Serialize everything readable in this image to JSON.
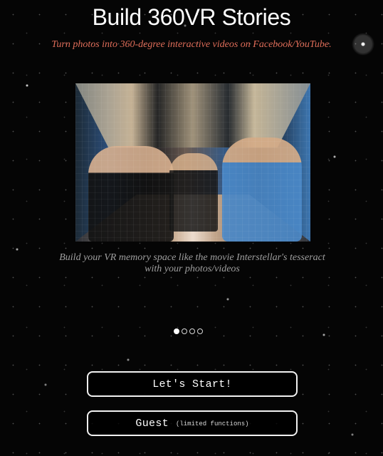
{
  "header": {
    "title": "Build 360VR Stories",
    "subtitle": "Turn photos into 360-degree interactive videos on Facebook/YouTube."
  },
  "hero": {
    "caption": "Build your VR memory space like the movie Interstellar's tesseract with your photos/videos"
  },
  "carousel": {
    "dots": [
      {
        "active": true
      },
      {
        "active": false
      },
      {
        "active": false
      },
      {
        "active": false
      }
    ]
  },
  "actions": {
    "start_label": "Let's Start!",
    "guest_label": "Guest",
    "guest_note": "(limited functions)"
  },
  "colors": {
    "background": "#050505",
    "subtitle": "#e06d59",
    "caption": "#9f9f9f",
    "button_border": "#f1f1f1",
    "text": "#ffffff"
  }
}
